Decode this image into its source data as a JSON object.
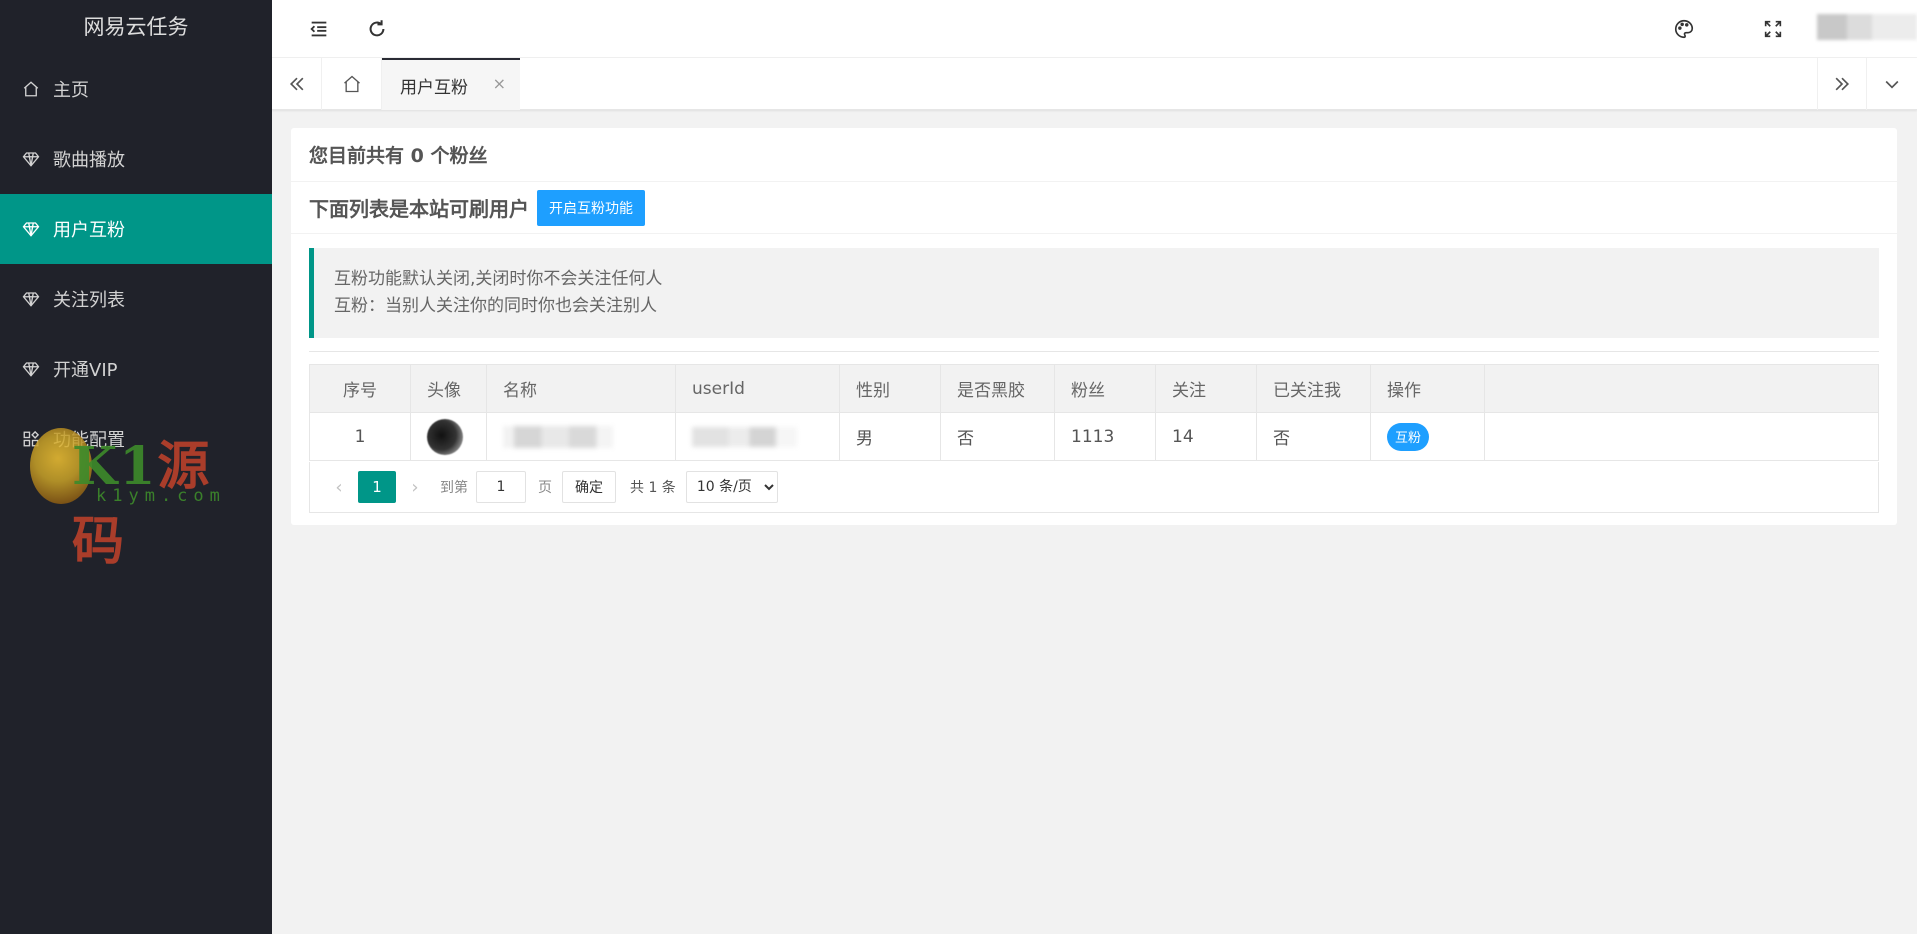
{
  "app": {
    "title": "网易云任务"
  },
  "sidebar": {
    "items": [
      {
        "label": "主页",
        "icon": "home-icon",
        "active": false
      },
      {
        "label": "歌曲播放",
        "icon": "diamond-icon",
        "active": false
      },
      {
        "label": "用户互粉",
        "icon": "diamond-icon",
        "active": true
      },
      {
        "label": "关注列表",
        "icon": "diamond-icon",
        "active": false
      },
      {
        "label": "开通VIP",
        "icon": "diamond-icon",
        "active": false
      },
      {
        "label": "功能配置",
        "icon": "apps-icon",
        "active": false
      }
    ],
    "accent_color": "#009688",
    "background": "#20222a"
  },
  "watermark": {
    "main": "K1源码",
    "sub": "k1ym.com"
  },
  "tabs": {
    "active": {
      "label": "用户互粉",
      "close": "×"
    }
  },
  "main": {
    "fans_summary": "您目前共有 0 个粉丝",
    "list_title": "下面列表是本站可刷用户",
    "open_button_label": "开启互粉功能",
    "notice": {
      "line1": "互粉功能默认关闭,关闭时你不会关注任何人",
      "line2": "互粉：当别人关注你的同时你也会关注别人"
    },
    "table": {
      "headers": [
        "序号",
        "头像",
        "名称",
        "userId",
        "性别",
        "是否黑胶",
        "粉丝",
        "关注",
        "已关注我",
        "操作"
      ],
      "rows": [
        {
          "index": "1",
          "gender": "男",
          "is_vip": "否",
          "fans": "1113",
          "follows": "14",
          "followed_me": "否",
          "action_label": "互粉"
        }
      ]
    },
    "pagination": {
      "current_page": "1",
      "goto_label": "到第",
      "page_input_value": "1",
      "page_suffix": "页",
      "confirm_label": "确定",
      "total_label": "共 1 条",
      "page_size_options": [
        "10 条/页"
      ],
      "page_size_selected": "10 条/页"
    }
  },
  "colors": {
    "primary_button": "#1e9fff",
    "theme": "#009688"
  }
}
